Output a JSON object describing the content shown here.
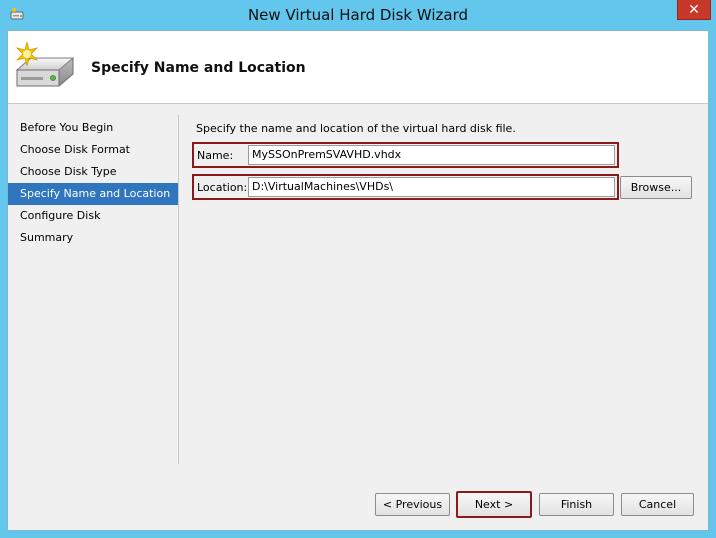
{
  "window": {
    "title": "New Virtual Hard Disk Wizard",
    "close_glyph": "✕",
    "app_icon": "wizard-app-icon"
  },
  "header": {
    "title": "Specify Name and Location",
    "icon": "new-disk-icon"
  },
  "nav": {
    "items": [
      {
        "label": "Before You Begin",
        "active": false
      },
      {
        "label": "Choose Disk Format",
        "active": false
      },
      {
        "label": "Choose Disk Type",
        "active": false
      },
      {
        "label": "Specify Name and Location",
        "active": true
      },
      {
        "label": "Configure Disk",
        "active": false
      },
      {
        "label": "Summary",
        "active": false
      }
    ]
  },
  "content": {
    "description": "Specify the name and location of the virtual hard disk file.",
    "name_label": "Name:",
    "name_value": "MySSOnPremSVAVHD.vhdx",
    "location_label": "Location:",
    "location_value": "D:\\VirtualMachines\\VHDs\\",
    "browse_label": "Browse..."
  },
  "buttons": {
    "previous": "< Previous",
    "next": "Next >",
    "finish": "Finish",
    "cancel": "Cancel"
  },
  "colors": {
    "accent": "#3076bf",
    "highlight_border": "#8b1a1a",
    "close": "#c7382b",
    "frame": "#63c6ec"
  }
}
